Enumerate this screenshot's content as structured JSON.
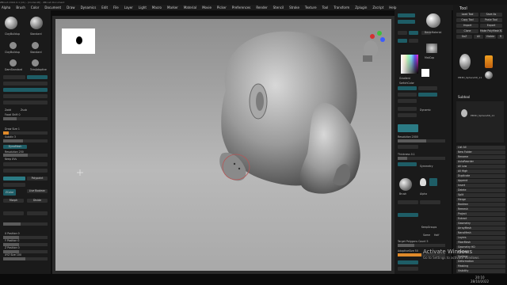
{
  "window": {
    "title": "ZBrush 2022.0.1 (x1) - [model.ztl] - ZBrush Document"
  },
  "menu": [
    "Alpha",
    "Brush",
    "Color",
    "Document",
    "Draw",
    "Dynamics",
    "Edit",
    "File",
    "Layer",
    "Light",
    "Macro",
    "Marker",
    "Material",
    "Movie",
    "Picker",
    "Preferences",
    "Render",
    "Stencil",
    "Stroke",
    "Texture",
    "Tool",
    "Transform",
    "Zplugin",
    "Zscript",
    "Help"
  ],
  "left_tray": {
    "brushes": [
      "ClayBuildup",
      "Standard",
      "ClayBuildup",
      "Standard",
      "DamStandard",
      "TrimAdaptive"
    ],
    "labels": {
      "focal": "Focal Shift 0",
      "draw": "Draw Size 1",
      "zadd": "Zadd",
      "zsub": "Zsub",
      "zintensity": "Z Intensity 25",
      "resolution": "Resolution 250",
      "keep_uvs": "Keep UVs",
      "polypaint": "Polypaint",
      "subdiv": "Subdiv 3",
      "dynamesh": "DynaMesh",
      "live_boolean": "Live Boolean",
      "zcolor": "ZColor",
      "morph": "Morph",
      "divide": "Divide",
      "xpos": "X Position 0",
      "ypos": "Y Position 0",
      "zpos": "Z Position 0",
      "xyz_size": "XYZ Size 100"
    }
  },
  "right_palette": {
    "materials": [
      "BasicMaterial",
      "MatCap",
      "SkinShade"
    ],
    "labels": {
      "gradient": "Gradient",
      "switch_color": "SwitchColor",
      "dynamic": "Dynamic",
      "resolution": "Resolution 2000",
      "thickness": "Thickness 0.1",
      "symmetry": "Symmetry",
      "brush": "Brush",
      "alpha": "Alpha",
      "keep_groups": "KeepGroups",
      "same": "Same",
      "half": "Half",
      "target_polygons": "Target Polygons Count 5",
      "adaptive_size": "AdaptiveSize 50"
    }
  },
  "tool_panel": {
    "title": "Tool",
    "buttons": [
      "Load Tool",
      "Save As",
      "Copy Tool",
      "Paste Tool",
      "Import",
      "Export",
      "Clone",
      "Make PolyMesh3D",
      "GoZ",
      "All",
      "Visible",
      "R"
    ],
    "subtool_label": "Subtool",
    "current_tool": "PM3D_Sphere3D_11",
    "subtool_items": [
      "PM3D_Sphere3D_11"
    ],
    "menu_items": [
      "List All",
      "New Folder",
      "Rename",
      "AutoReorder",
      "All Low",
      "All High",
      "Duplicate",
      "Append",
      "Insert",
      "Delete",
      "Split",
      "Merge",
      "Boolean",
      "Remesh",
      "Project",
      "Extract",
      "Geometry",
      "ArrayMesh",
      "NanoMesh",
      "Layers",
      "FiberMesh",
      "Geometry HD",
      "Preview",
      "Surface",
      "Deformation",
      "Masking",
      "Visibility"
    ]
  },
  "viewport": {
    "cursor": "crosshair"
  },
  "watermark": {
    "line1": "Activate Windows",
    "line2": "Go to Settings to activate Windows."
  },
  "taskbar": {
    "time": "20:10",
    "date": "28/10/2022"
  }
}
